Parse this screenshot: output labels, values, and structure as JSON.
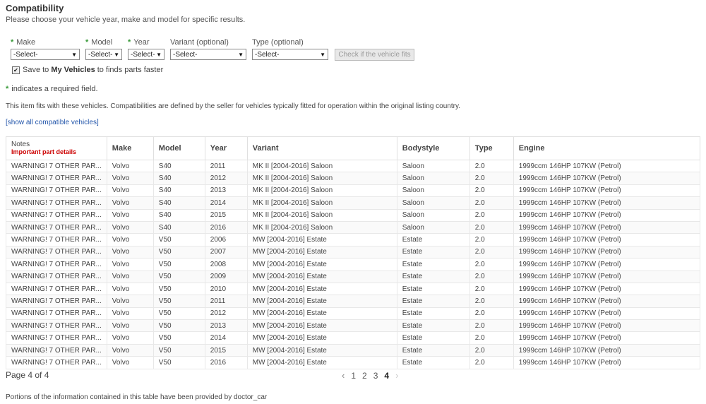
{
  "header": {
    "title": "Compatibility",
    "subtitle": "Please choose your vehicle year, make and model for specific results."
  },
  "form": {
    "make_label": "Make",
    "model_label": "Model",
    "year_label": "Year",
    "variant_label": "Variant (optional)",
    "type_label": "Type (optional)",
    "make_value": "-Select-",
    "model_value": "-Select-",
    "year_value": "-Select-",
    "variant_value": "-Select-",
    "type_value": "-Select-",
    "check_button": "Check if the vehicle fits",
    "save_prefix": "Save to",
    "save_bold": "My Vehicles",
    "save_suffix": "to finds parts faster",
    "required_note": "indicates a required field."
  },
  "info": {
    "fits_text": "This item fits with these vehicles. Compatibilities are defined by the seller for vehicles typically fitted for operation within the original listing country.",
    "show_all": "[show all compatible vehicles]"
  },
  "table": {
    "headers": {
      "notes": "Notes",
      "notes_sub": "Important part details",
      "make": "Make",
      "model": "Model",
      "year": "Year",
      "variant": "Variant",
      "bodystyle": "Bodystyle",
      "type": "Type",
      "engine": "Engine"
    },
    "rows": [
      [
        "WARNING! 7 OTHER PAR...",
        "Volvo",
        "S40",
        "2011",
        "MK II [2004-2016] Saloon",
        "Saloon",
        "2.0",
        "1999ccm 146HP 107KW (Petrol)"
      ],
      [
        "WARNING! 7 OTHER PAR...",
        "Volvo",
        "S40",
        "2012",
        "MK II [2004-2016] Saloon",
        "Saloon",
        "2.0",
        "1999ccm 146HP 107KW (Petrol)"
      ],
      [
        "WARNING! 7 OTHER PAR...",
        "Volvo",
        "S40",
        "2013",
        "MK II [2004-2016] Saloon",
        "Saloon",
        "2.0",
        "1999ccm 146HP 107KW (Petrol)"
      ],
      [
        "WARNING! 7 OTHER PAR...",
        "Volvo",
        "S40",
        "2014",
        "MK II [2004-2016] Saloon",
        "Saloon",
        "2.0",
        "1999ccm 146HP 107KW (Petrol)"
      ],
      [
        "WARNING! 7 OTHER PAR...",
        "Volvo",
        "S40",
        "2015",
        "MK II [2004-2016] Saloon",
        "Saloon",
        "2.0",
        "1999ccm 146HP 107KW (Petrol)"
      ],
      [
        "WARNING! 7 OTHER PAR...",
        "Volvo",
        "S40",
        "2016",
        "MK II [2004-2016] Saloon",
        "Saloon",
        "2.0",
        "1999ccm 146HP 107KW (Petrol)"
      ],
      [
        "WARNING! 7 OTHER PAR...",
        "Volvo",
        "V50",
        "2006",
        "MW [2004-2016] Estate",
        "Estate",
        "2.0",
        "1999ccm 146HP 107KW (Petrol)"
      ],
      [
        "WARNING! 7 OTHER PAR...",
        "Volvo",
        "V50",
        "2007",
        "MW [2004-2016] Estate",
        "Estate",
        "2.0",
        "1999ccm 146HP 107KW (Petrol)"
      ],
      [
        "WARNING! 7 OTHER PAR...",
        "Volvo",
        "V50",
        "2008",
        "MW [2004-2016] Estate",
        "Estate",
        "2.0",
        "1999ccm 146HP 107KW (Petrol)"
      ],
      [
        "WARNING! 7 OTHER PAR...",
        "Volvo",
        "V50",
        "2009",
        "MW [2004-2016] Estate",
        "Estate",
        "2.0",
        "1999ccm 146HP 107KW (Petrol)"
      ],
      [
        "WARNING! 7 OTHER PAR...",
        "Volvo",
        "V50",
        "2010",
        "MW [2004-2016] Estate",
        "Estate",
        "2.0",
        "1999ccm 146HP 107KW (Petrol)"
      ],
      [
        "WARNING! 7 OTHER PAR...",
        "Volvo",
        "V50",
        "2011",
        "MW [2004-2016] Estate",
        "Estate",
        "2.0",
        "1999ccm 146HP 107KW (Petrol)"
      ],
      [
        "WARNING! 7 OTHER PAR...",
        "Volvo",
        "V50",
        "2012",
        "MW [2004-2016] Estate",
        "Estate",
        "2.0",
        "1999ccm 146HP 107KW (Petrol)"
      ],
      [
        "WARNING! 7 OTHER PAR...",
        "Volvo",
        "V50",
        "2013",
        "MW [2004-2016] Estate",
        "Estate",
        "2.0",
        "1999ccm 146HP 107KW (Petrol)"
      ],
      [
        "WARNING! 7 OTHER PAR...",
        "Volvo",
        "V50",
        "2014",
        "MW [2004-2016] Estate",
        "Estate",
        "2.0",
        "1999ccm 146HP 107KW (Petrol)"
      ],
      [
        "WARNING! 7 OTHER PAR...",
        "Volvo",
        "V50",
        "2015",
        "MW [2004-2016] Estate",
        "Estate",
        "2.0",
        "1999ccm 146HP 107KW (Petrol)"
      ],
      [
        "WARNING! 7 OTHER PAR...",
        "Volvo",
        "V50",
        "2016",
        "MW [2004-2016] Estate",
        "Estate",
        "2.0",
        "1999ccm 146HP 107KW (Petrol)"
      ]
    ]
  },
  "pagination": {
    "page_info": "Page 4 of 4",
    "prev_icon": "‹",
    "pages": [
      "1",
      "2",
      "3",
      "4"
    ],
    "current": "4",
    "next_icon": "›"
  },
  "footer": {
    "note": "Portions of the information contained in this table have been provided by doctor_car"
  },
  "icons": {
    "required_star": "*",
    "checkbox_checked": "✔",
    "select_arrow": "▼"
  },
  "colors": {
    "required_star": "#3a9a3a",
    "important_text": "#cc0000",
    "link": "#2255aa"
  }
}
